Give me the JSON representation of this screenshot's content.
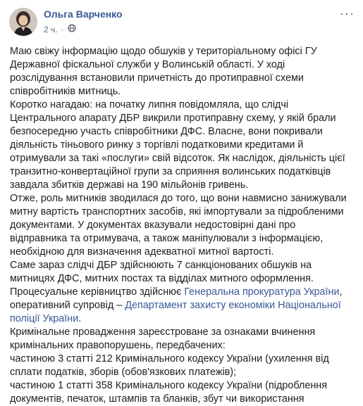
{
  "post": {
    "author": "Ольга Варченко",
    "time": "2 ч.",
    "dot": "·",
    "more_glyph": "···",
    "icons": {
      "audience": "globe-icon",
      "more": "more-options-icon"
    },
    "paragraphs": {
      "p1": "Маю свіжу інформацію щодо обшуків у територіальному офісі ГУ Державної фіскальної служби у Волинській області. У ході розслідування встановили причетність до протиправної схеми співробітників митниць.",
      "p2": "Коротко нагадаю: на початку липня повідомляла, що слідчі Центрального апарату ДБР викрили протиправну схему, у якій брали безпосередню участь співробітники ДФС. Власне, вони покривали діяльність тіньового ринку з торгівлі податковими кредитами й отримували за такі «послуги» свій відсоток. Як наслідок, діяльність цієї транзитно-конвертаційної групи за сприяння волинських податківців завдала збитків державі на 190 мільйонів гривень.",
      "p3": "Отже, роль митників зводилася до того, що вони навмисно занижували митну вартість транспортних засобів, які імпортували за підробленими документами. У документах вказували недостовірні дані про відправника та отримувача, а також маніпулювали з інформацією, необхідною для визначення адекватної митної вартості.",
      "p4": "Саме зараз слідчі ДБР здійснюють 7 санкціонованих обшуків на митницях ДФС, митних постах та відділах митного оформлення.",
      "p5_pre": "Процесуальне керівництво здійснює ",
      "p5_link1": "Генеральна прокуратура України",
      "p5_mid": ", оперативний супровід – ",
      "p5_link2": "Департамент захисту економіки Національної поліції України",
      "p5_post": ".",
      "p6": "Кримінальне провадження зареєстроване за ознаками вчинення кримінальних правопорушень, передбачених:",
      "p7": "частиною 3 статті 212 Кримінального кодексу України (ухилення від сплати податків, зборів (обов'язкових платежів);",
      "p8": "частиною 1 статті 358 Кримінального кодексу України (підроблення документів, печаток, штампів та бланків, збут чи використання"
    }
  }
}
